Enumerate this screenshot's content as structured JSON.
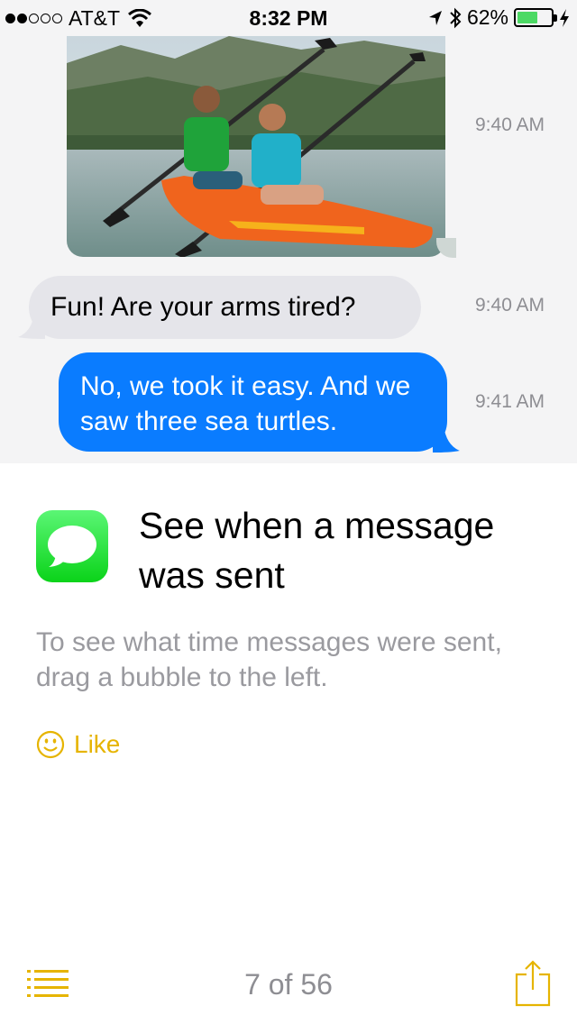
{
  "status_bar": {
    "carrier": "AT&T",
    "time": "8:32 PM",
    "battery_percent": "62%",
    "battery_level": 0.62,
    "signal_dots_filled": 2,
    "signal_dots_total": 5
  },
  "conversation": {
    "photo_timestamp": "9:40 AM",
    "messages": [
      {
        "side": "received",
        "text": "Fun! Are your arms tired?",
        "timestamp": "9:40 AM"
      },
      {
        "side": "sent",
        "text": "No, we took it easy. And we saw three sea turtles.",
        "timestamp": "9:41 AM"
      }
    ]
  },
  "tip": {
    "icon": "messages-app-icon",
    "title": "See when a message was sent",
    "body": "To see what time messages were sent, drag a bubble to the left.",
    "like_label": "Like"
  },
  "toolbar": {
    "page_counter": "7 of 56"
  },
  "colors": {
    "accent": "#e6b400",
    "sent_bubble": "#0a7cff",
    "received_bubble": "#e5e5ea",
    "timestamp": "#8e8e93",
    "body_text": "#9a9a9f",
    "app_icon_green": "#22d83a"
  }
}
